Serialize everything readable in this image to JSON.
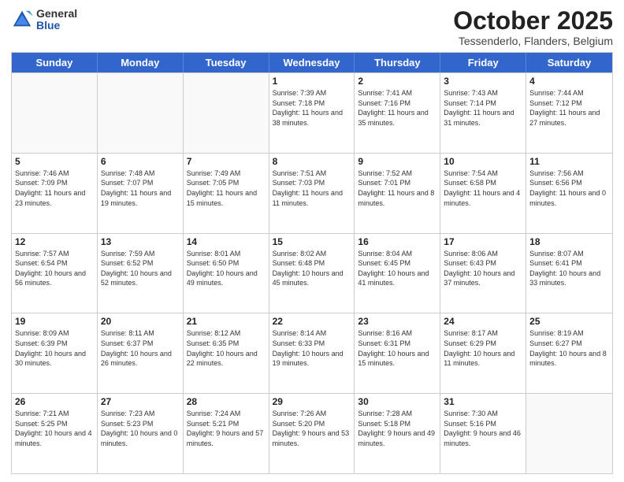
{
  "header": {
    "logo": {
      "general": "General",
      "blue": "Blue"
    },
    "title": "October 2025",
    "location": "Tessenderlo, Flanders, Belgium"
  },
  "weekdays": [
    "Sunday",
    "Monday",
    "Tuesday",
    "Wednesday",
    "Thursday",
    "Friday",
    "Saturday"
  ],
  "weeks": [
    [
      {
        "day": "",
        "info": ""
      },
      {
        "day": "",
        "info": ""
      },
      {
        "day": "",
        "info": ""
      },
      {
        "day": "1",
        "info": "Sunrise: 7:39 AM\nSunset: 7:18 PM\nDaylight: 11 hours\nand 38 minutes."
      },
      {
        "day": "2",
        "info": "Sunrise: 7:41 AM\nSunset: 7:16 PM\nDaylight: 11 hours\nand 35 minutes."
      },
      {
        "day": "3",
        "info": "Sunrise: 7:43 AM\nSunset: 7:14 PM\nDaylight: 11 hours\nand 31 minutes."
      },
      {
        "day": "4",
        "info": "Sunrise: 7:44 AM\nSunset: 7:12 PM\nDaylight: 11 hours\nand 27 minutes."
      }
    ],
    [
      {
        "day": "5",
        "info": "Sunrise: 7:46 AM\nSunset: 7:09 PM\nDaylight: 11 hours\nand 23 minutes."
      },
      {
        "day": "6",
        "info": "Sunrise: 7:48 AM\nSunset: 7:07 PM\nDaylight: 11 hours\nand 19 minutes."
      },
      {
        "day": "7",
        "info": "Sunrise: 7:49 AM\nSunset: 7:05 PM\nDaylight: 11 hours\nand 15 minutes."
      },
      {
        "day": "8",
        "info": "Sunrise: 7:51 AM\nSunset: 7:03 PM\nDaylight: 11 hours\nand 11 minutes."
      },
      {
        "day": "9",
        "info": "Sunrise: 7:52 AM\nSunset: 7:01 PM\nDaylight: 11 hours\nand 8 minutes."
      },
      {
        "day": "10",
        "info": "Sunrise: 7:54 AM\nSunset: 6:58 PM\nDaylight: 11 hours\nand 4 minutes."
      },
      {
        "day": "11",
        "info": "Sunrise: 7:56 AM\nSunset: 6:56 PM\nDaylight: 11 hours\nand 0 minutes."
      }
    ],
    [
      {
        "day": "12",
        "info": "Sunrise: 7:57 AM\nSunset: 6:54 PM\nDaylight: 10 hours\nand 56 minutes."
      },
      {
        "day": "13",
        "info": "Sunrise: 7:59 AM\nSunset: 6:52 PM\nDaylight: 10 hours\nand 52 minutes."
      },
      {
        "day": "14",
        "info": "Sunrise: 8:01 AM\nSunset: 6:50 PM\nDaylight: 10 hours\nand 49 minutes."
      },
      {
        "day": "15",
        "info": "Sunrise: 8:02 AM\nSunset: 6:48 PM\nDaylight: 10 hours\nand 45 minutes."
      },
      {
        "day": "16",
        "info": "Sunrise: 8:04 AM\nSunset: 6:45 PM\nDaylight: 10 hours\nand 41 minutes."
      },
      {
        "day": "17",
        "info": "Sunrise: 8:06 AM\nSunset: 6:43 PM\nDaylight: 10 hours\nand 37 minutes."
      },
      {
        "day": "18",
        "info": "Sunrise: 8:07 AM\nSunset: 6:41 PM\nDaylight: 10 hours\nand 33 minutes."
      }
    ],
    [
      {
        "day": "19",
        "info": "Sunrise: 8:09 AM\nSunset: 6:39 PM\nDaylight: 10 hours\nand 30 minutes."
      },
      {
        "day": "20",
        "info": "Sunrise: 8:11 AM\nSunset: 6:37 PM\nDaylight: 10 hours\nand 26 minutes."
      },
      {
        "day": "21",
        "info": "Sunrise: 8:12 AM\nSunset: 6:35 PM\nDaylight: 10 hours\nand 22 minutes."
      },
      {
        "day": "22",
        "info": "Sunrise: 8:14 AM\nSunset: 6:33 PM\nDaylight: 10 hours\nand 19 minutes."
      },
      {
        "day": "23",
        "info": "Sunrise: 8:16 AM\nSunset: 6:31 PM\nDaylight: 10 hours\nand 15 minutes."
      },
      {
        "day": "24",
        "info": "Sunrise: 8:17 AM\nSunset: 6:29 PM\nDaylight: 10 hours\nand 11 minutes."
      },
      {
        "day": "25",
        "info": "Sunrise: 8:19 AM\nSunset: 6:27 PM\nDaylight: 10 hours\nand 8 minutes."
      }
    ],
    [
      {
        "day": "26",
        "info": "Sunrise: 7:21 AM\nSunset: 5:25 PM\nDaylight: 10 hours\nand 4 minutes."
      },
      {
        "day": "27",
        "info": "Sunrise: 7:23 AM\nSunset: 5:23 PM\nDaylight: 10 hours\nand 0 minutes."
      },
      {
        "day": "28",
        "info": "Sunrise: 7:24 AM\nSunset: 5:21 PM\nDaylight: 9 hours\nand 57 minutes."
      },
      {
        "day": "29",
        "info": "Sunrise: 7:26 AM\nSunset: 5:20 PM\nDaylight: 9 hours\nand 53 minutes."
      },
      {
        "day": "30",
        "info": "Sunrise: 7:28 AM\nSunset: 5:18 PM\nDaylight: 9 hours\nand 49 minutes."
      },
      {
        "day": "31",
        "info": "Sunrise: 7:30 AM\nSunset: 5:16 PM\nDaylight: 9 hours\nand 46 minutes."
      },
      {
        "day": "",
        "info": ""
      }
    ]
  ]
}
